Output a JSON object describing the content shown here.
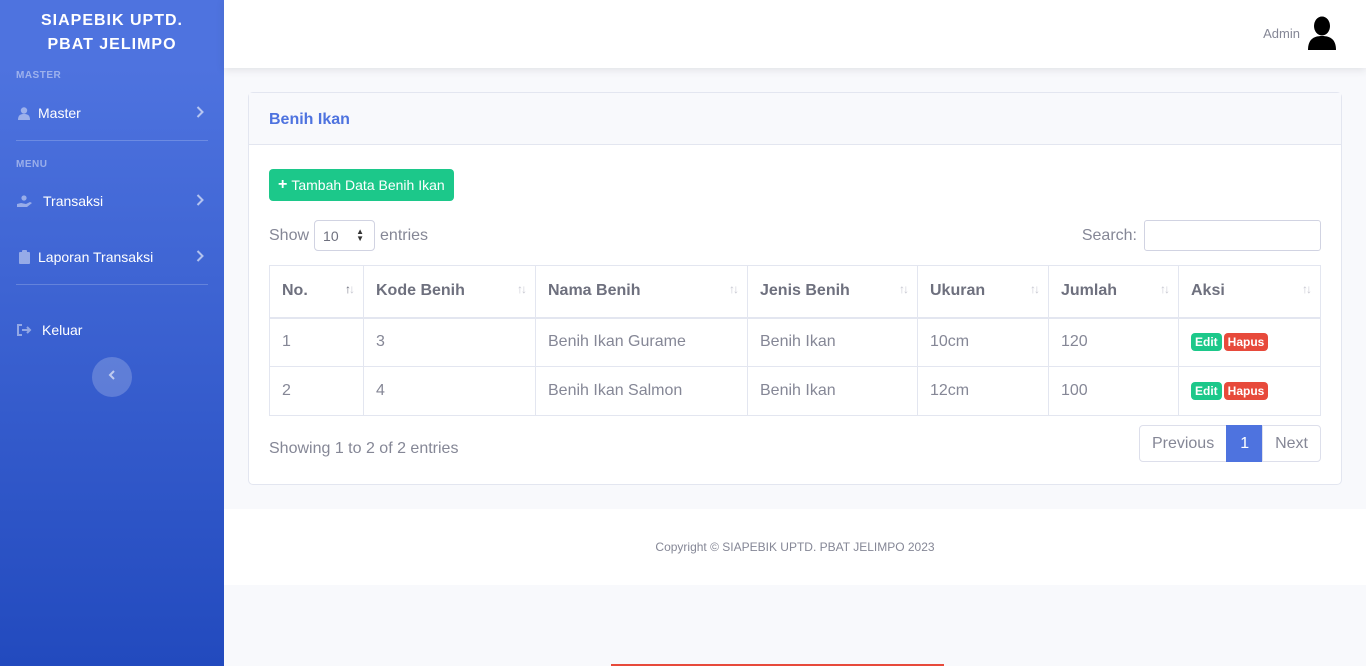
{
  "brand": {
    "line1": "SIAPEBIK UPTD.",
    "line2": "PBAT JELIMPO"
  },
  "sidebar": {
    "heading_master": "MASTER",
    "heading_menu": "MENU",
    "items": [
      {
        "label": "Master",
        "icon": "user-icon"
      },
      {
        "label": "Transaksi",
        "icon": "hand-holding-icon"
      },
      {
        "label": "Laporan Transaksi",
        "icon": "clipboard-icon"
      },
      {
        "label": "Keluar",
        "icon": "sign-out-icon"
      }
    ]
  },
  "topbar": {
    "user_name": "Admin"
  },
  "card": {
    "title": "Benih Ikan",
    "add_button": "Tambah Data Benih Ikan",
    "show_label": "Show",
    "entries_label": "entries",
    "page_length": "10",
    "search_label": "Search:",
    "search_value": ""
  },
  "table": {
    "columns": [
      "No.",
      "Kode Benih",
      "Nama Benih",
      "Jenis Benih",
      "Ukuran",
      "Jumlah",
      "Aksi"
    ],
    "rows": [
      {
        "no": "1",
        "kode": "3",
        "nama": "Benih Ikan Gurame",
        "jenis": "Benih Ikan",
        "ukuran": "10cm",
        "jumlah": "120"
      },
      {
        "no": "2",
        "kode": "4",
        "nama": "Benih Ikan Salmon",
        "jenis": "Benih Ikan",
        "ukuran": "12cm",
        "jumlah": "100"
      }
    ],
    "edit_label": "Edit",
    "delete_label": "Hapus"
  },
  "pagination": {
    "info": "Showing 1 to 2 of 2 entries",
    "previous": "Previous",
    "current": "1",
    "next": "Next"
  },
  "footer": {
    "copyright": "Copyright © SIAPEBIK UPTD. PBAT JELIMPO 2023"
  },
  "colors": {
    "primary": "#4e73df",
    "success": "#1cc88a",
    "danger": "#e74a3b"
  }
}
